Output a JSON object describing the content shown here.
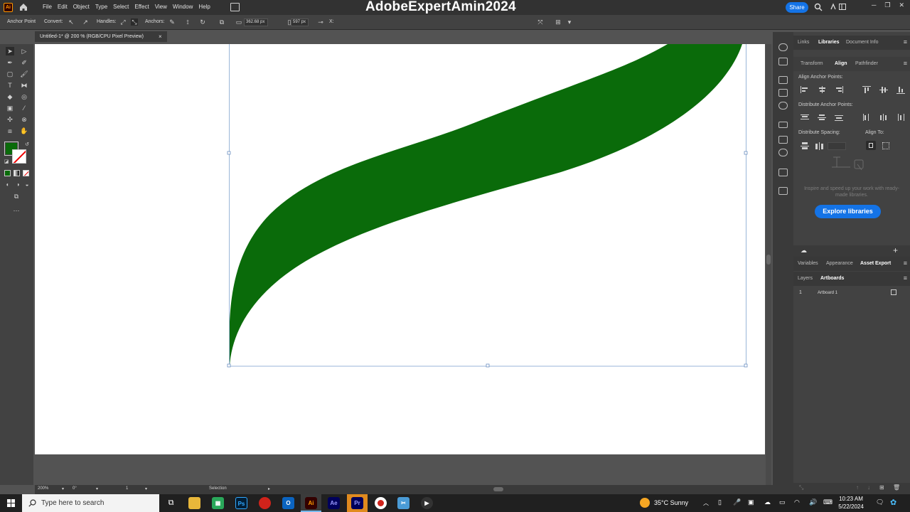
{
  "menubar": {
    "items": [
      "File",
      "Edit",
      "Object",
      "Type",
      "Select",
      "Effect",
      "View",
      "Window",
      "Help"
    ],
    "overlay_title": "AdobeExpertAmin2024",
    "share_label": "Share"
  },
  "controlbar": {
    "tool_label": "Anchor Point",
    "convert_label": "Convert:",
    "handles_label": "Handles:",
    "anchors_label": "Anchors:",
    "x_value": "362.68 px",
    "y_value": "597 px",
    "x_label": "X:"
  },
  "document": {
    "tab_title": "Untitled-1* @ 200 % (RGB/CPU Pixel Preview)",
    "close_label": "×"
  },
  "toolbar": {
    "fill_color": "#0a6b0a"
  },
  "artwork": {
    "fill_color": "#0a6b0a",
    "selection_color": "#9ab6d8"
  },
  "statusbar": {
    "zoom": "200%",
    "rotation": "0°",
    "artboard_index": "1",
    "tool_name": "Selection"
  },
  "panel": {
    "top_tabs": [
      "Links",
      "Libraries",
      "Document Info"
    ],
    "top_active": "Libraries",
    "sub_tabs": [
      "Transform",
      "Align",
      "Pathfinder"
    ],
    "sub_active": "Align",
    "align_anchor_points": "Align Anchor Points:",
    "distribute_anchor_points": "Distribute Anchor Points:",
    "distribute_spacing": "Distribute Spacing:",
    "align_to": "Align To:",
    "inspire_text": "Inspire and speed up your work with ready-made libraries.",
    "explore_label": "Explore libraries",
    "mid_tabs": [
      "Variables",
      "Appearance",
      "Asset Export"
    ],
    "mid_active": "Asset Export",
    "bottom_tabs": [
      "Layers",
      "Artboards"
    ],
    "bottom_active": "Artboards",
    "artboard_row": {
      "number": "1",
      "name": "Artboard 1"
    }
  },
  "taskbar": {
    "search_placeholder": "Type here to search",
    "weather": "35°C  Sunny",
    "time": "10:23 AM",
    "date": "5/22/2024",
    "apps": [
      "Ps",
      "Ai",
      "Ae",
      "Pr"
    ]
  }
}
